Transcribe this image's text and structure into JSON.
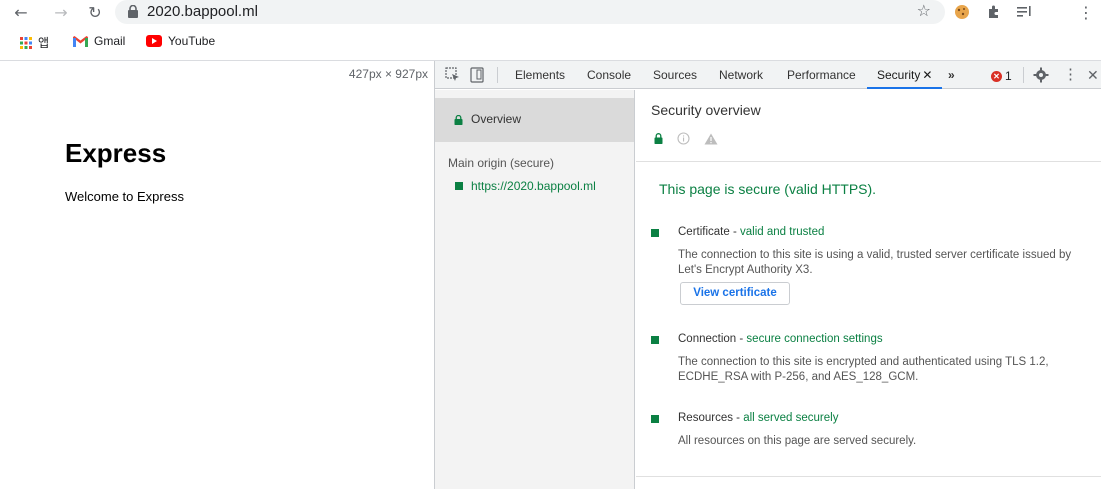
{
  "browser": {
    "url": "2020.bappool.ml",
    "bookmarks": [
      {
        "label": "앱",
        "icon": "apps-grid-icon"
      },
      {
        "label": "Gmail",
        "icon": "gmail-icon"
      },
      {
        "label": "YouTube",
        "icon": "youtube-icon"
      }
    ]
  },
  "viewport": {
    "dimensions": "427px × 927px",
    "heading": "Express",
    "paragraph": "Welcome to Express"
  },
  "devtools": {
    "tabs": [
      "Elements",
      "Console",
      "Sources",
      "Network",
      "Performance",
      "Security"
    ],
    "active_tab": "Security",
    "more_tabs": "»",
    "error_count": "1",
    "sidebar": {
      "overview": "Overview",
      "origin_title": "Main origin (secure)",
      "origin_url": "https://2020.bappool.ml"
    },
    "main": {
      "title": "Security overview",
      "summary": "This page is secure (valid HTTPS).",
      "explanations": [
        {
          "title": "Certificate",
          "highlight": "valid and trusted",
          "desc": "The connection to this site is using a valid, trusted server certificate issued by Let's Encrypt Authority X3."
        },
        {
          "title": "Connection",
          "highlight": "secure connection settings",
          "desc": "The connection to this site is encrypted and authenticated using TLS 1.2, ECDHE_RSA with P-256, and AES_128_GCM."
        },
        {
          "title": "Resources",
          "highlight": "all served securely",
          "desc": "All resources on this page are served securely."
        }
      ],
      "view_certificate": "View certificate"
    }
  },
  "colors": {
    "secure_green": "#0b8043",
    "accent_blue": "#1a73e8",
    "error_red": "#d93025"
  }
}
